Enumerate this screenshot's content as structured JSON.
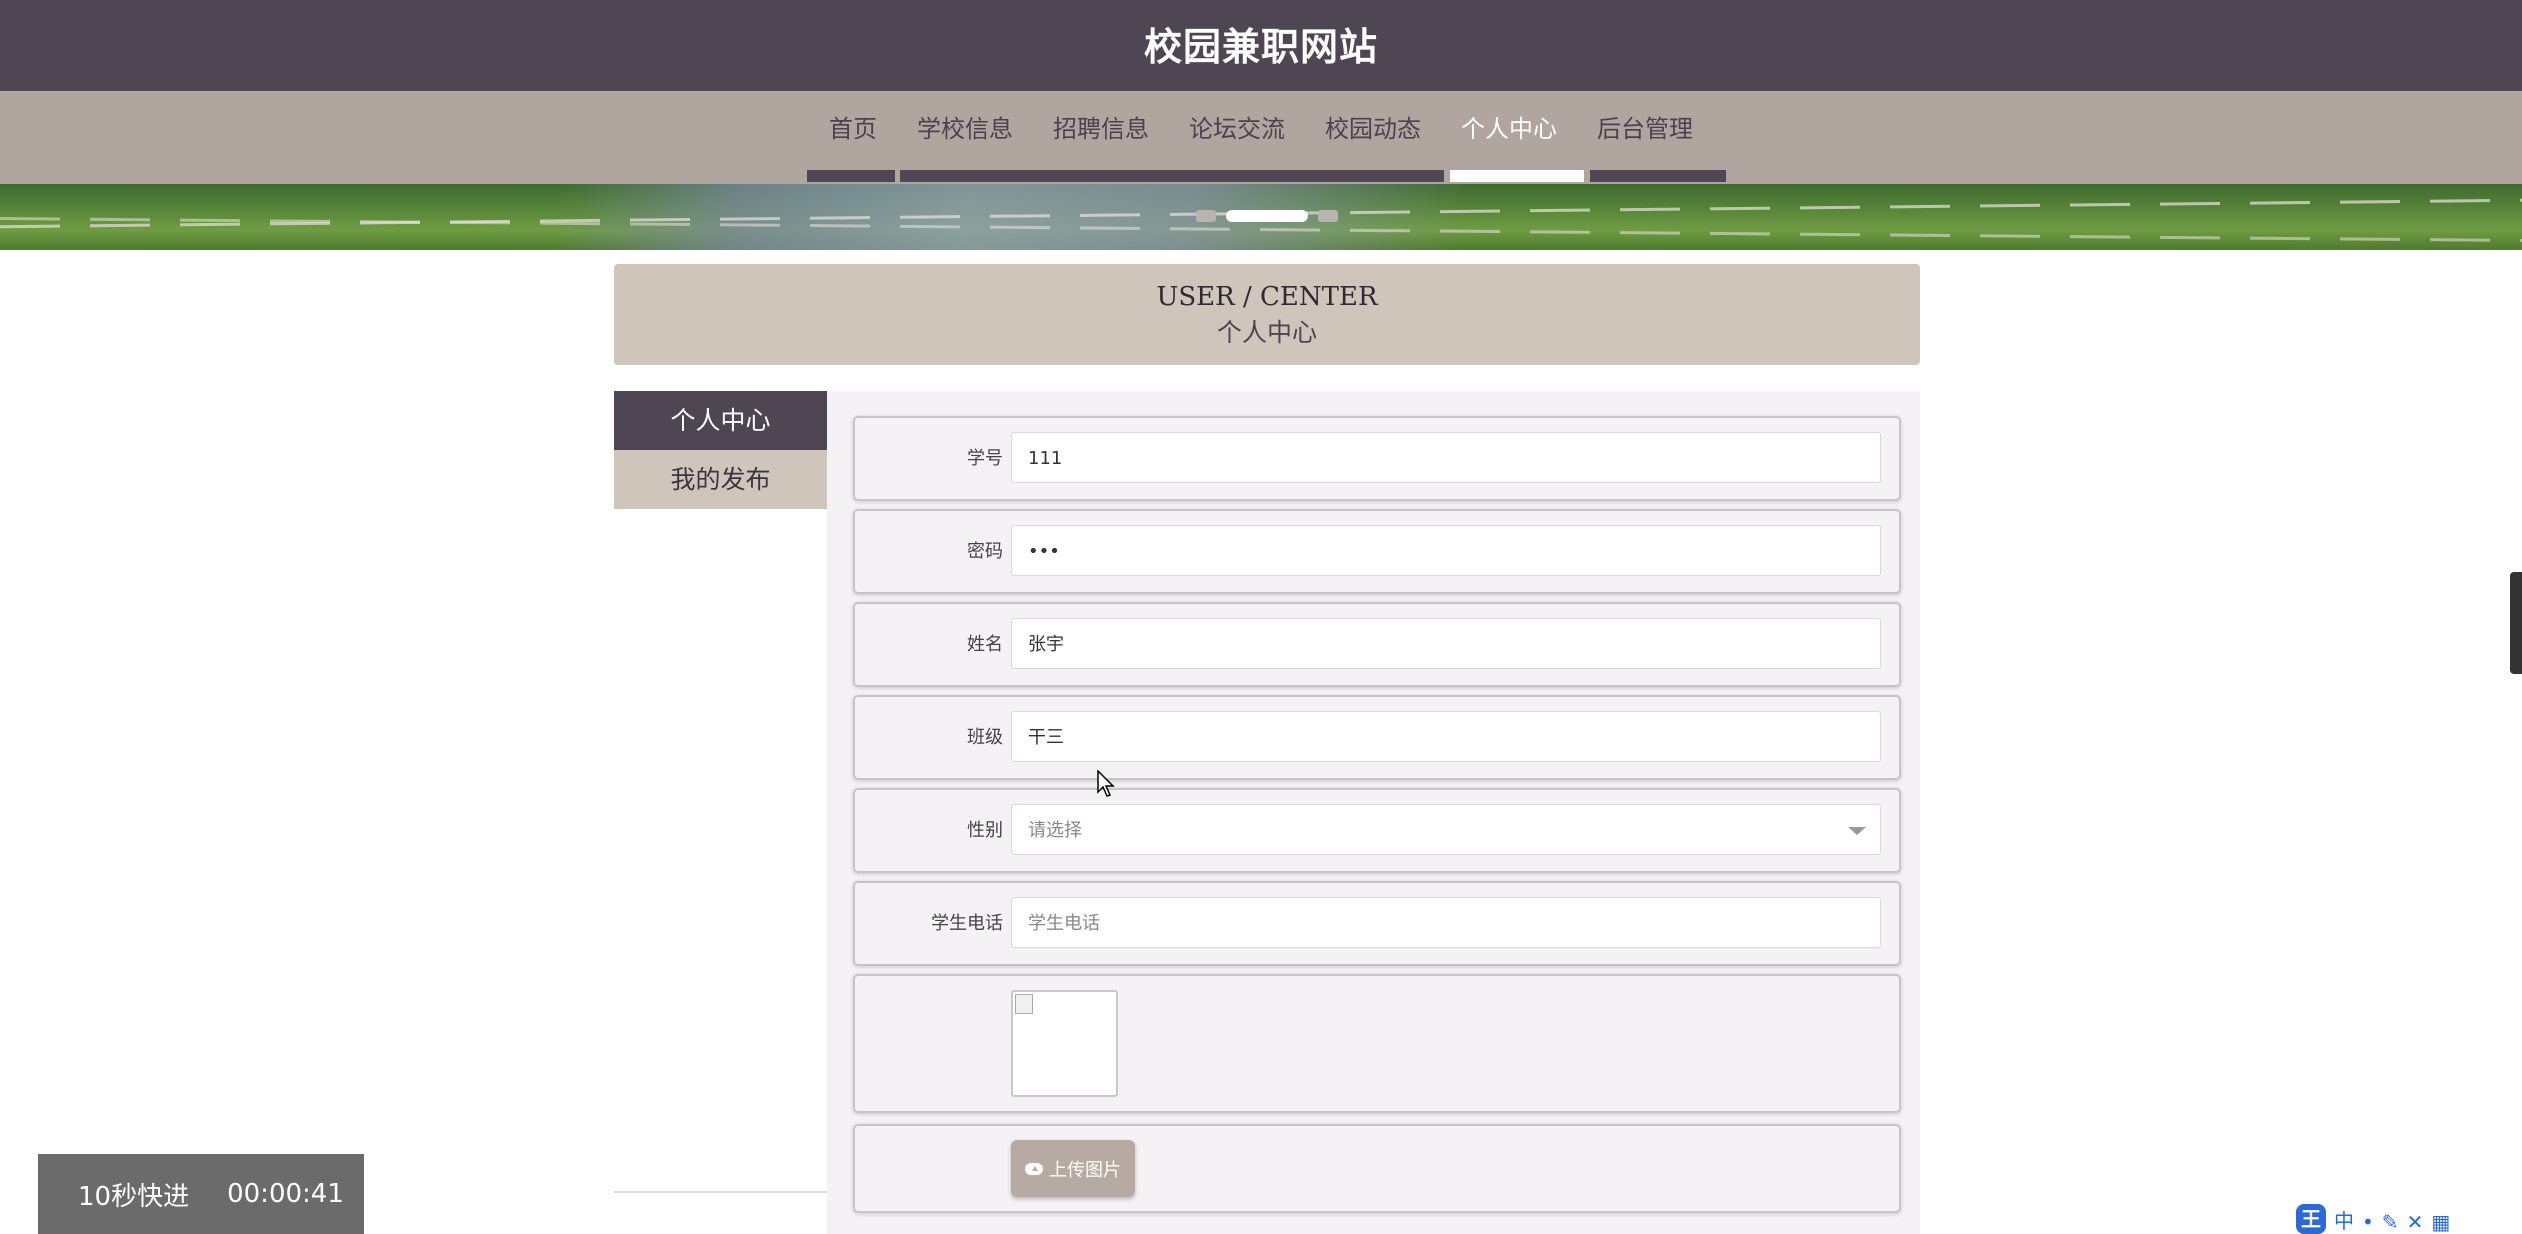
{
  "site": {
    "title": "校园兼职网站"
  },
  "nav": {
    "items": [
      {
        "label": "首页"
      },
      {
        "label": "学校信息"
      },
      {
        "label": "招聘信息"
      },
      {
        "label": "论坛交流"
      },
      {
        "label": "校园动态"
      },
      {
        "label": "个人中心"
      },
      {
        "label": "后台管理"
      }
    ],
    "active_index": 5
  },
  "page_header": {
    "en": "USER / CENTER",
    "cn": "个人中心"
  },
  "sidebar": {
    "items": [
      {
        "label": "个人中心"
      },
      {
        "label": "我的发布"
      }
    ]
  },
  "form": {
    "student_id": {
      "label": "学号",
      "value": "111"
    },
    "password": {
      "label": "密码",
      "value": "•••"
    },
    "name": {
      "label": "姓名",
      "value": "张宇"
    },
    "class": {
      "label": "班级",
      "value": "干三"
    },
    "gender": {
      "label": "性别",
      "placeholder": "请选择"
    },
    "phone": {
      "label": "学生电话",
      "placeholder": "学生电话"
    },
    "upload_button": "上传图片"
  },
  "video_overlay": {
    "skip_label": "10秒快进",
    "time": "00:00:41"
  },
  "ime_toolbar": {
    "badge": "王",
    "mode": "中"
  },
  "colors": {
    "header_bg": "#4f4654",
    "nav_bg": "#b1a59f",
    "page_header_bg": "#cfc5bb",
    "panel_bg": "#f4f2f4",
    "upload_btn": "#b7aaa2"
  }
}
